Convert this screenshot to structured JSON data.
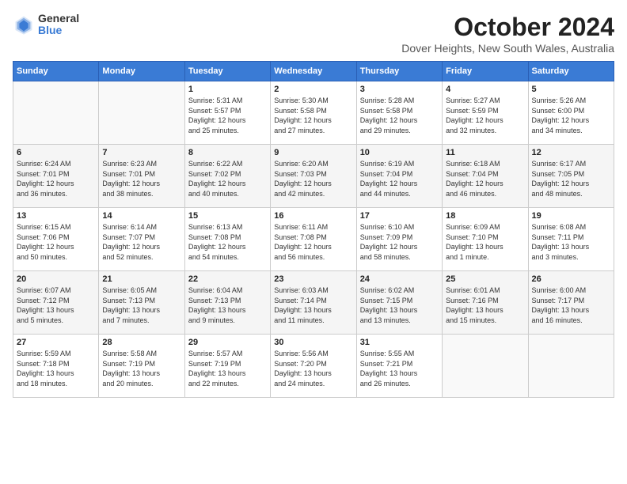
{
  "logo": {
    "general": "General",
    "blue": "Blue"
  },
  "title": {
    "month": "October 2024",
    "location": "Dover Heights, New South Wales, Australia"
  },
  "headers": [
    "Sunday",
    "Monday",
    "Tuesday",
    "Wednesday",
    "Thursday",
    "Friday",
    "Saturday"
  ],
  "weeks": [
    [
      {
        "day": "",
        "info": ""
      },
      {
        "day": "",
        "info": ""
      },
      {
        "day": "1",
        "info": "Sunrise: 5:31 AM\nSunset: 5:57 PM\nDaylight: 12 hours\nand 25 minutes."
      },
      {
        "day": "2",
        "info": "Sunrise: 5:30 AM\nSunset: 5:58 PM\nDaylight: 12 hours\nand 27 minutes."
      },
      {
        "day": "3",
        "info": "Sunrise: 5:28 AM\nSunset: 5:58 PM\nDaylight: 12 hours\nand 29 minutes."
      },
      {
        "day": "4",
        "info": "Sunrise: 5:27 AM\nSunset: 5:59 PM\nDaylight: 12 hours\nand 32 minutes."
      },
      {
        "day": "5",
        "info": "Sunrise: 5:26 AM\nSunset: 6:00 PM\nDaylight: 12 hours\nand 34 minutes."
      }
    ],
    [
      {
        "day": "6",
        "info": "Sunrise: 6:24 AM\nSunset: 7:01 PM\nDaylight: 12 hours\nand 36 minutes."
      },
      {
        "day": "7",
        "info": "Sunrise: 6:23 AM\nSunset: 7:01 PM\nDaylight: 12 hours\nand 38 minutes."
      },
      {
        "day": "8",
        "info": "Sunrise: 6:22 AM\nSunset: 7:02 PM\nDaylight: 12 hours\nand 40 minutes."
      },
      {
        "day": "9",
        "info": "Sunrise: 6:20 AM\nSunset: 7:03 PM\nDaylight: 12 hours\nand 42 minutes."
      },
      {
        "day": "10",
        "info": "Sunrise: 6:19 AM\nSunset: 7:04 PM\nDaylight: 12 hours\nand 44 minutes."
      },
      {
        "day": "11",
        "info": "Sunrise: 6:18 AM\nSunset: 7:04 PM\nDaylight: 12 hours\nand 46 minutes."
      },
      {
        "day": "12",
        "info": "Sunrise: 6:17 AM\nSunset: 7:05 PM\nDaylight: 12 hours\nand 48 minutes."
      }
    ],
    [
      {
        "day": "13",
        "info": "Sunrise: 6:15 AM\nSunset: 7:06 PM\nDaylight: 12 hours\nand 50 minutes."
      },
      {
        "day": "14",
        "info": "Sunrise: 6:14 AM\nSunset: 7:07 PM\nDaylight: 12 hours\nand 52 minutes."
      },
      {
        "day": "15",
        "info": "Sunrise: 6:13 AM\nSunset: 7:08 PM\nDaylight: 12 hours\nand 54 minutes."
      },
      {
        "day": "16",
        "info": "Sunrise: 6:11 AM\nSunset: 7:08 PM\nDaylight: 12 hours\nand 56 minutes."
      },
      {
        "day": "17",
        "info": "Sunrise: 6:10 AM\nSunset: 7:09 PM\nDaylight: 12 hours\nand 58 minutes."
      },
      {
        "day": "18",
        "info": "Sunrise: 6:09 AM\nSunset: 7:10 PM\nDaylight: 13 hours\nand 1 minute."
      },
      {
        "day": "19",
        "info": "Sunrise: 6:08 AM\nSunset: 7:11 PM\nDaylight: 13 hours\nand 3 minutes."
      }
    ],
    [
      {
        "day": "20",
        "info": "Sunrise: 6:07 AM\nSunset: 7:12 PM\nDaylight: 13 hours\nand 5 minutes."
      },
      {
        "day": "21",
        "info": "Sunrise: 6:05 AM\nSunset: 7:13 PM\nDaylight: 13 hours\nand 7 minutes."
      },
      {
        "day": "22",
        "info": "Sunrise: 6:04 AM\nSunset: 7:13 PM\nDaylight: 13 hours\nand 9 minutes."
      },
      {
        "day": "23",
        "info": "Sunrise: 6:03 AM\nSunset: 7:14 PM\nDaylight: 13 hours\nand 11 minutes."
      },
      {
        "day": "24",
        "info": "Sunrise: 6:02 AM\nSunset: 7:15 PM\nDaylight: 13 hours\nand 13 minutes."
      },
      {
        "day": "25",
        "info": "Sunrise: 6:01 AM\nSunset: 7:16 PM\nDaylight: 13 hours\nand 15 minutes."
      },
      {
        "day": "26",
        "info": "Sunrise: 6:00 AM\nSunset: 7:17 PM\nDaylight: 13 hours\nand 16 minutes."
      }
    ],
    [
      {
        "day": "27",
        "info": "Sunrise: 5:59 AM\nSunset: 7:18 PM\nDaylight: 13 hours\nand 18 minutes."
      },
      {
        "day": "28",
        "info": "Sunrise: 5:58 AM\nSunset: 7:19 PM\nDaylight: 13 hours\nand 20 minutes."
      },
      {
        "day": "29",
        "info": "Sunrise: 5:57 AM\nSunset: 7:19 PM\nDaylight: 13 hours\nand 22 minutes."
      },
      {
        "day": "30",
        "info": "Sunrise: 5:56 AM\nSunset: 7:20 PM\nDaylight: 13 hours\nand 24 minutes."
      },
      {
        "day": "31",
        "info": "Sunrise: 5:55 AM\nSunset: 7:21 PM\nDaylight: 13 hours\nand 26 minutes."
      },
      {
        "day": "",
        "info": ""
      },
      {
        "day": "",
        "info": ""
      }
    ]
  ]
}
